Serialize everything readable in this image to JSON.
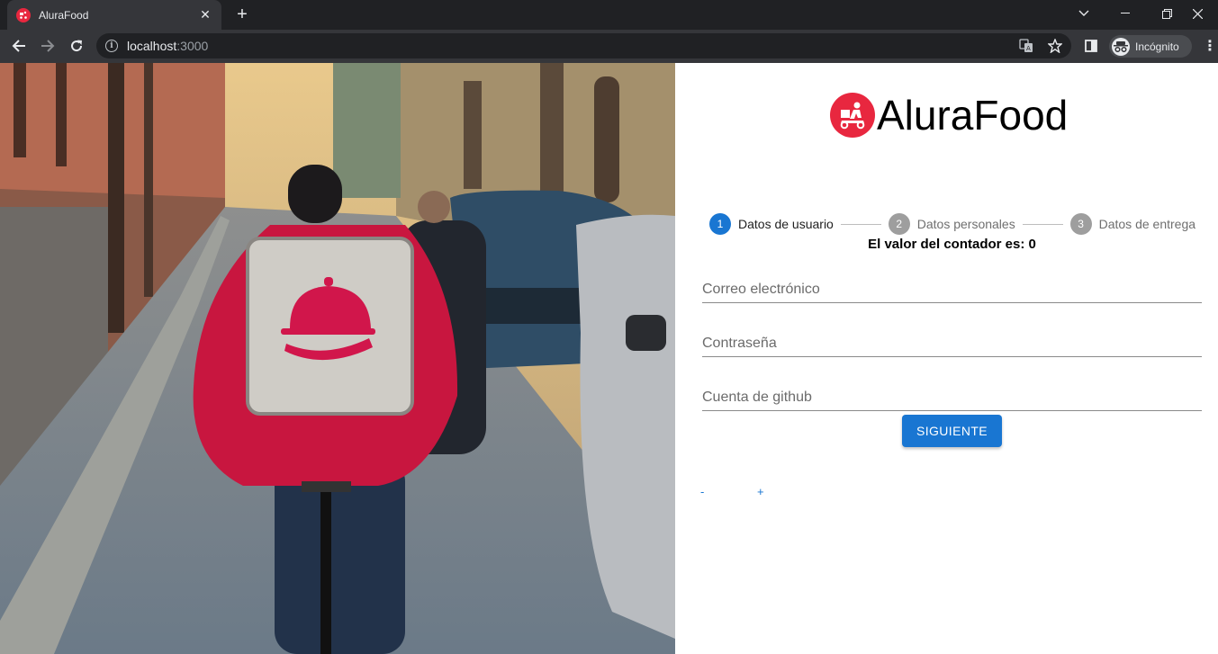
{
  "browser": {
    "tab_title": "AluraFood",
    "url_host": "localhost",
    "url_port": ":3000",
    "profile_label": "Incógnito"
  },
  "brand": {
    "name": "AluraFood",
    "color": "#e8273f"
  },
  "stepper": {
    "steps": [
      {
        "number": "1",
        "label": "Datos de usuario",
        "active": true
      },
      {
        "number": "2",
        "label": "Datos personales",
        "active": false
      },
      {
        "number": "3",
        "label": "Datos de entrega",
        "active": false
      }
    ],
    "active_color": "#1976d2",
    "inactive_color": "#9e9e9e"
  },
  "counter_text": "El valor del contador es: 0",
  "form": {
    "email_placeholder": "Correo electrónico",
    "password_placeholder": "Contraseña",
    "github_placeholder": "Cuenta de github",
    "submit_label": "SIGUIENTE"
  },
  "counter_controls": {
    "decrement_label": "-",
    "increment_label": "+"
  },
  "icons": [
    "delivery-scooter-icon",
    "back-arrow-icon",
    "forward-arrow-icon",
    "reload-icon",
    "info-icon",
    "translate-icon",
    "star-icon",
    "side-panel-icon",
    "incognito-icon",
    "more-icon"
  ]
}
